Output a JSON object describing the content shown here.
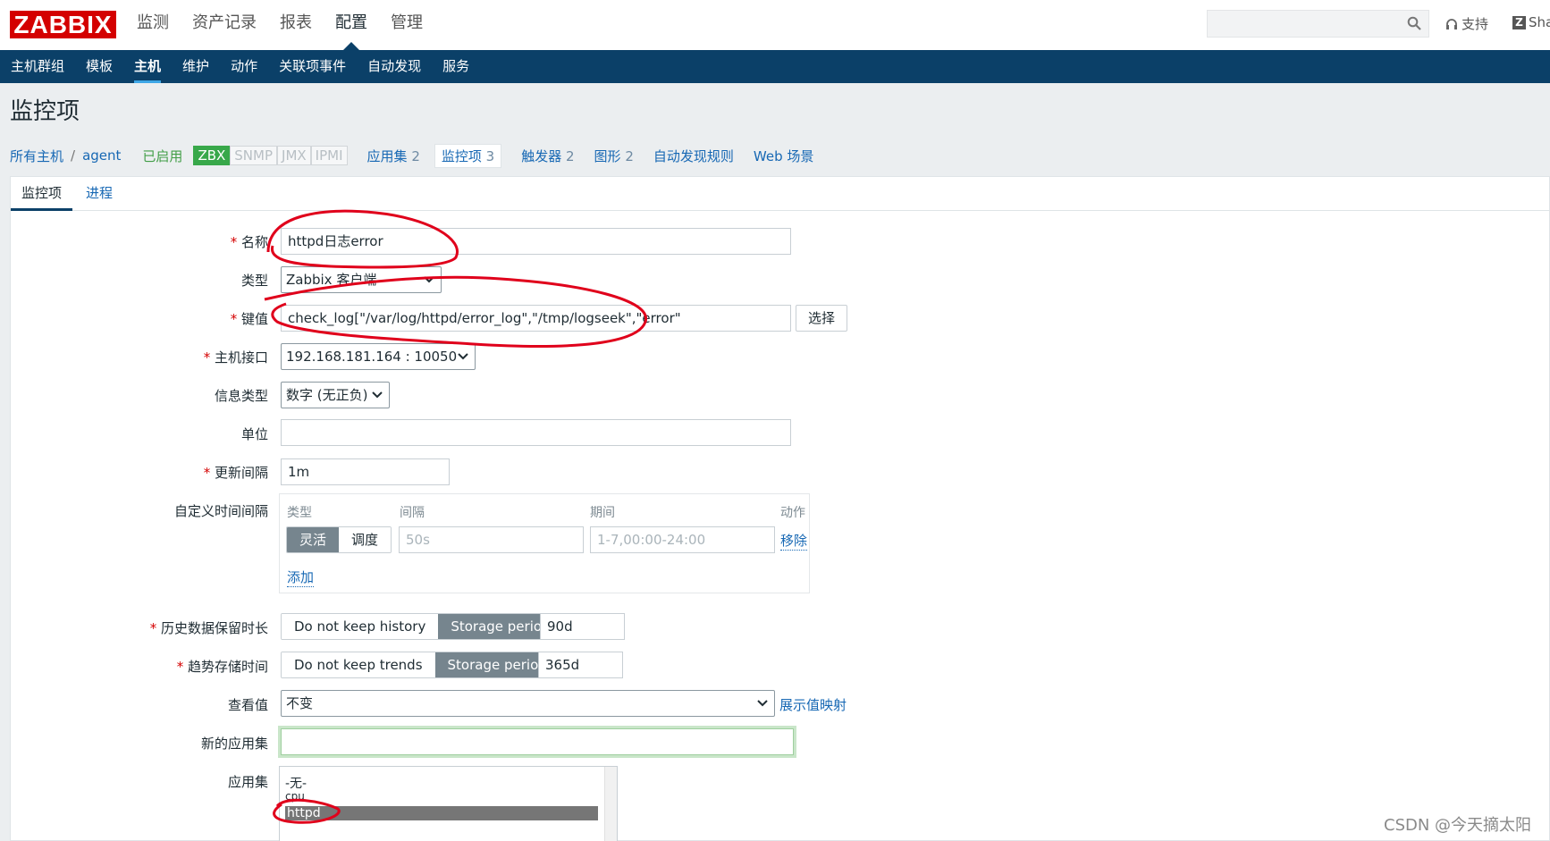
{
  "app": {
    "logo": "ZABBIX",
    "main_menu": [
      "监测",
      "资产记录",
      "报表",
      "配置",
      "管理"
    ],
    "main_menu_active": "配置",
    "support_label": "支持",
    "share_label": "Sha"
  },
  "submenu": [
    "主机群组",
    "模板",
    "主机",
    "维护",
    "动作",
    "关联项事件",
    "自动发现",
    "服务"
  ],
  "submenu_active": "主机",
  "page_title": "监控项",
  "host_nav": {
    "all_hosts": "所有主机",
    "separator": "/",
    "host": "agent",
    "status": "已启用",
    "availability": [
      "ZBX",
      "SNMP",
      "JMX",
      "IPMI"
    ],
    "tabs": [
      {
        "label": "应用集",
        "count": "2"
      },
      {
        "label": "监控项",
        "count": "3"
      },
      {
        "label": "触发器",
        "count": "2"
      },
      {
        "label": "图形",
        "count": "2"
      },
      {
        "label": "自动发现规则",
        "count": ""
      },
      {
        "label": "Web 场景",
        "count": ""
      }
    ]
  },
  "form_tabs": [
    "监控项",
    "进程"
  ],
  "form": {
    "name_label": "名称",
    "name_value": "httpd日志error",
    "type_label": "类型",
    "type_value": "Zabbix 客户端",
    "key_label": "键值",
    "key_value": "check_log[\"/var/log/httpd/error_log\",\"/tmp/logseek\",\"error\"",
    "key_select_button": "选择",
    "interface_label": "主机接口",
    "interface_value": "192.168.181.164 : 10050",
    "info_type_label": "信息类型",
    "info_type_value": "数字 (无正负)",
    "units_label": "单位",
    "units_value": "",
    "update_label": "更新间隔",
    "update_value": "1m",
    "custom_intervals_label": "自定义时间间隔",
    "custom_intervals": {
      "col_type": "类型",
      "col_interval": "间隔",
      "col_period": "期间",
      "col_action": "动作",
      "type_options": [
        "灵活",
        "调度"
      ],
      "type_selected": "灵活",
      "interval_placeholder": "50s",
      "period_placeholder": "1-7,00:00-24:00",
      "remove_link": "移除",
      "add_link": "添加"
    },
    "history_label": "历史数据保留时长",
    "history_options": [
      "Do not keep history",
      "Storage period"
    ],
    "history_value": "90d",
    "trends_label": "趋势存储时间",
    "trends_options": [
      "Do not keep trends",
      "Storage period"
    ],
    "trends_value": "365d",
    "value_map_label": "查看值",
    "value_map_value": "不变",
    "value_map_link": "展示值映射",
    "new_app_label": "新的应用集",
    "new_app_value": "",
    "apps_label": "应用集",
    "apps_list": [
      "-无-",
      "cpu",
      "httpd"
    ],
    "apps_selected": "httpd"
  },
  "watermark": "CSDN @今天摘太阳",
  "colors": {
    "brand": "#d40000",
    "nav_bg": "#0b4068",
    "link": "#1768b4",
    "annotation": "#e0001b"
  }
}
